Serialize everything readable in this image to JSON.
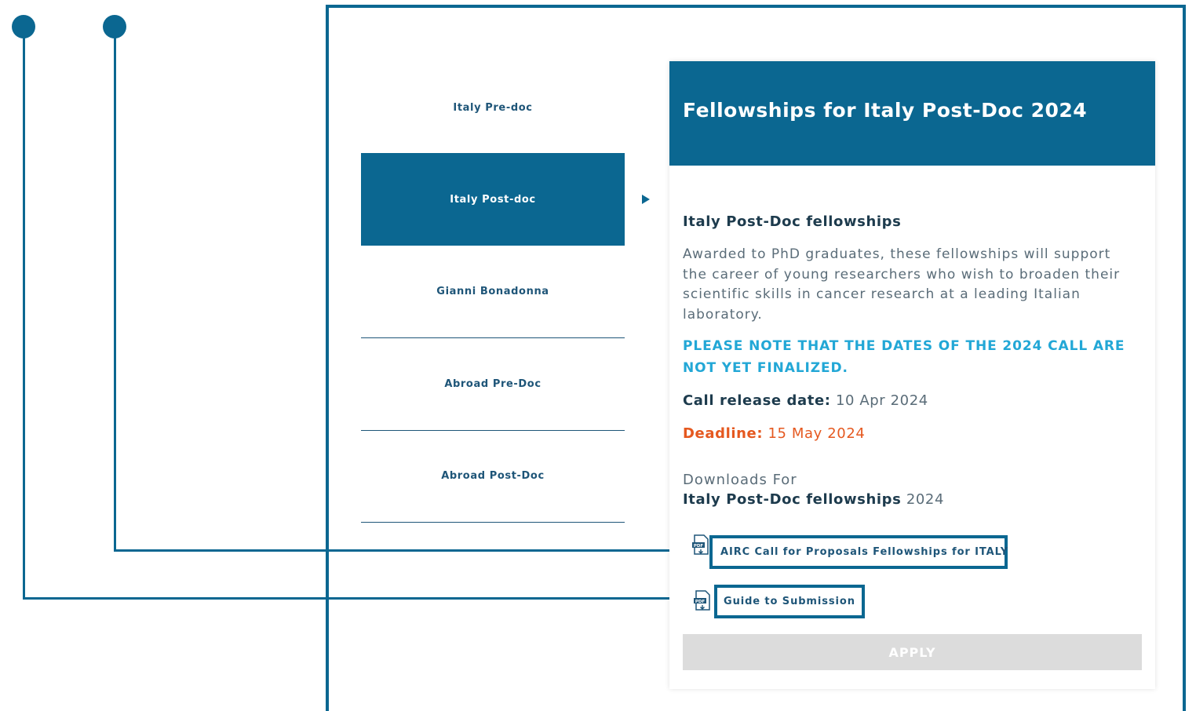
{
  "tabs": [
    {
      "label": "Italy Pre-doc",
      "active": false
    },
    {
      "label": "Italy Post-doc",
      "active": true
    },
    {
      "label": "Gianni Bonadonna",
      "active": false
    },
    {
      "label": "Abroad Pre-Doc",
      "active": false
    },
    {
      "label": "Abroad Post-Doc",
      "active": false
    }
  ],
  "panel": {
    "title": "Fellowships for Italy Post-Doc 2024",
    "section_heading": "Italy Post-Doc fellowships",
    "description": "Awarded to PhD graduates, these fellowships will support the career of young researchers who wish to broaden their scientific skills in cancer research at a leading Italian laboratory.",
    "notice": "PLEASE NOTE THAT THE DATES OF THE 2024 CALL ARE NOT YET FINALIZED.",
    "release_label": "Call release date:",
    "release_value": "10 Apr 2024",
    "deadline_label": "Deadline:",
    "deadline_value": "15 May 2024",
    "downloads_label": "Downloads For",
    "downloads_title": "Italy Post-Doc fellowships",
    "downloads_year": "2024",
    "downloads": [
      {
        "label": "AIRC Call for Proposals Fellowships for ITALY",
        "icon": "pdf-icon"
      },
      {
        "label": "Guide to Submission",
        "icon": "pdf-icon"
      }
    ],
    "pdf_icon_text": "PDF",
    "apply_label": "APPLY"
  },
  "colors": {
    "brand": "#0b6791",
    "notice": "#22a7d6",
    "deadline": "#e5581f",
    "apply_disabled": "#dcdcdc"
  }
}
